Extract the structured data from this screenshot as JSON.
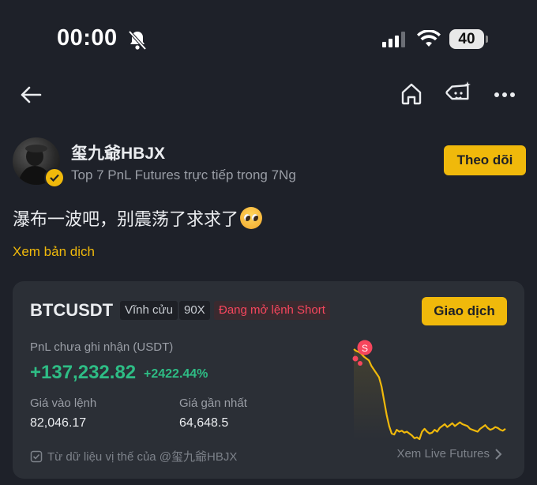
{
  "status_bar": {
    "time": "00:00",
    "battery": "40"
  },
  "nav": {
    "icons": [
      "back-arrow-icon",
      "home-icon",
      "tag-sparkle-icon",
      "more-icon"
    ]
  },
  "author": {
    "name": "玺九爺HBJX",
    "subtitle": "Top 7 PnL Futures trực tiếp trong 7Ng",
    "follow_label": "Theo dõi"
  },
  "post": {
    "text": "瀑布一波吧，别震荡了求求了",
    "translate_label": "Xem bản dịch"
  },
  "card": {
    "symbol": "BTCUSDT",
    "tags": [
      "Vĩnh cửu",
      "90X",
      "Đang mở lệnh Short"
    ],
    "trade_label": "Giao dịch",
    "pnl_label": "PnL chưa ghi nhận (USDT)",
    "pnl_value": "+137,232.82",
    "pnl_percent": "+2422.44%",
    "entry_label": "Giá vào lệnh",
    "entry_value": "82,046.17",
    "last_label": "Giá gần nhất",
    "last_value": "64,648.5",
    "source_note": "Từ dữ liệu vị thế của @玺九爺HBJX",
    "live_link": "Xem Live Futures",
    "marker_label": "S"
  },
  "colors": {
    "accent": "#f0b90b",
    "positive": "#2ebd85",
    "negative": "#f6465d",
    "background": "#1e2129",
    "card": "#2b2f36"
  },
  "chart_data": {
    "type": "line",
    "series": [
      {
        "values": [
          100,
          98,
          97,
          95,
          92,
          90,
          88,
          82,
          78,
          74,
          70,
          60,
          45,
          30,
          18,
          10,
          9,
          14,
          12,
          13,
          11,
          12,
          10,
          8,
          5,
          6,
          4,
          12,
          15,
          12,
          10,
          11,
          14,
          12,
          16,
          18,
          20,
          17,
          19,
          21,
          18,
          20,
          22,
          20,
          19,
          18,
          15,
          14,
          13,
          12,
          15,
          17,
          19,
          16,
          14,
          15,
          17,
          16,
          14,
          13,
          15
        ]
      }
    ]
  }
}
